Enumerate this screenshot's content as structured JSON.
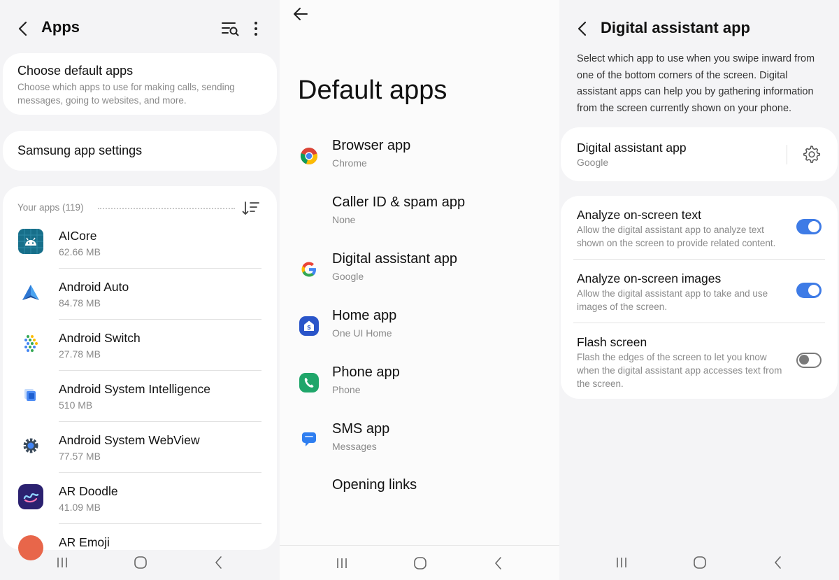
{
  "apps_screen": {
    "title": "Apps",
    "choose_default": {
      "title": "Choose default apps",
      "subtitle": "Choose which apps to use for making calls, sending messages, going to websites, and more."
    },
    "samsung_settings": "Samsung app settings",
    "your_apps_label": "Your apps (119)",
    "apps": [
      {
        "name": "AICore",
        "size": "62.66 MB",
        "icon": "aicore-icon"
      },
      {
        "name": "Android Auto",
        "size": "84.78 MB",
        "icon": "android-auto-icon"
      },
      {
        "name": "Android Switch",
        "size": "27.78 MB",
        "icon": "android-switch-icon"
      },
      {
        "name": "Android System Intelligence",
        "size": "510 MB",
        "icon": "android-system-intelligence-icon"
      },
      {
        "name": "Android System WebView",
        "size": "77.57 MB",
        "icon": "webview-icon"
      },
      {
        "name": "AR Doodle",
        "size": "41.09 MB",
        "icon": "ar-doodle-icon"
      },
      {
        "name": "AR Emoji",
        "size": "",
        "icon": "ar-emoji-icon"
      }
    ]
  },
  "default_apps_screen": {
    "title": "Default apps",
    "items": [
      {
        "name": "Browser app",
        "sub": "Chrome",
        "icon": "chrome-icon"
      },
      {
        "name": "Caller ID & spam app",
        "sub": "None",
        "icon": ""
      },
      {
        "name": "Digital assistant app",
        "sub": "Google",
        "icon": "google-icon"
      },
      {
        "name": "Home app",
        "sub": "One UI Home",
        "icon": "one-ui-home-icon"
      },
      {
        "name": "Phone app",
        "sub": "Phone",
        "icon": "phone-icon"
      },
      {
        "name": "SMS app",
        "sub": "Messages",
        "icon": "messages-icon"
      },
      {
        "name": "Opening links",
        "sub": "",
        "icon": ""
      }
    ]
  },
  "digital_assistant_screen": {
    "title": "Digital assistant app",
    "description": "Select which app to use when you swipe inward from one of the bottom corners of the screen. Digital assistant apps can help you by gathering information from the screen currently shown on your phone.",
    "assistant": {
      "title": "Digital assistant app",
      "value": "Google"
    },
    "toggles": [
      {
        "title": "Analyze on-screen text",
        "desc": "Allow the digital assistant app to analyze text shown on the screen to provide related content.",
        "on": true
      },
      {
        "title": "Analyze on-screen images",
        "desc": "Allow the digital assistant app to take and use images of the screen.",
        "on": true
      },
      {
        "title": "Flash screen",
        "desc": "Flash the edges of the screen to let you know when the digital assistant app accesses text from the screen.",
        "on": false
      }
    ],
    "accent_color": "#3e7be6"
  }
}
